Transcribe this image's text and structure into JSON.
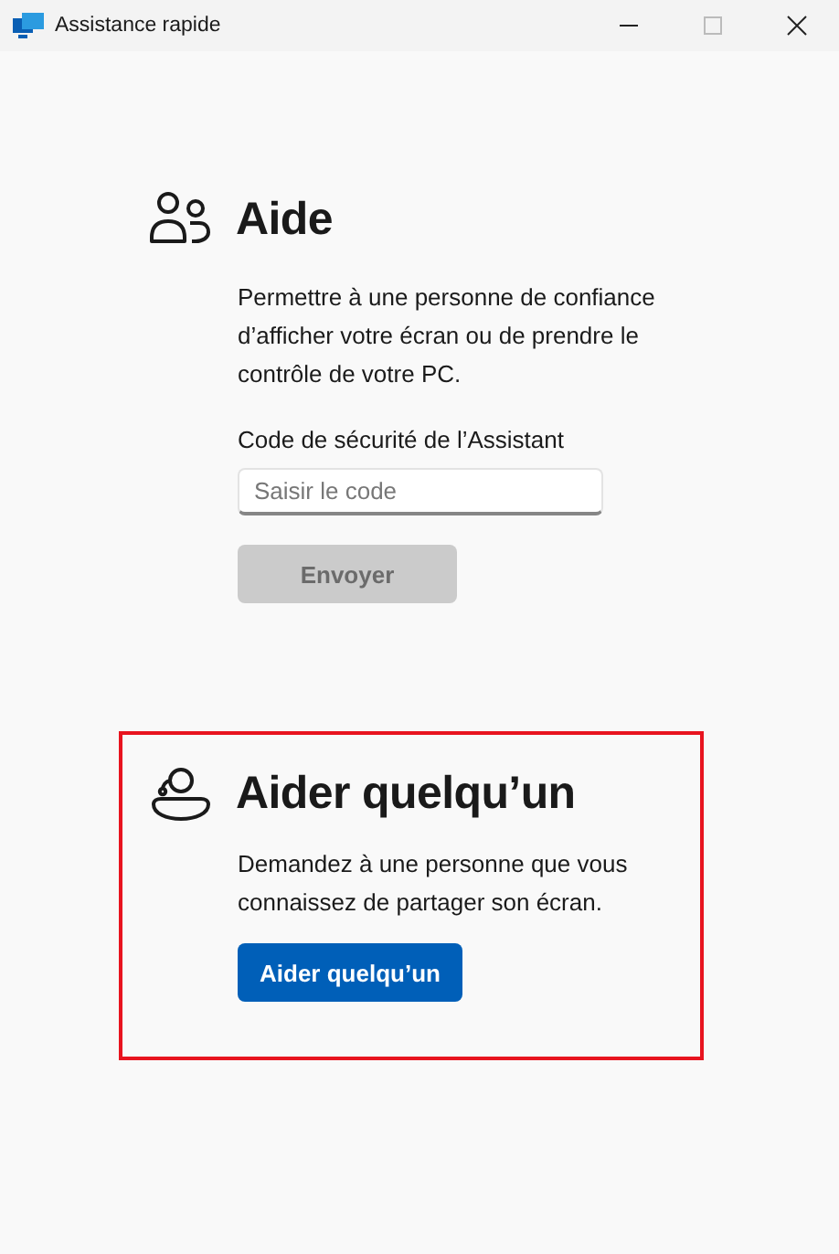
{
  "window": {
    "title": "Assistance rapide"
  },
  "get_help": {
    "heading": "Aide",
    "description": "Permettre à une personne de confiance d’afficher votre écran ou de prendre le contrôle de votre PC.",
    "code_label": "Code de sécurité de l’Assistant",
    "code_field": {
      "placeholder": "Saisir le code"
    },
    "submit_button": {
      "label": "Envoyer",
      "disabled": true
    }
  },
  "help_someone": {
    "heading": "Aider quelqu’un",
    "description": "Demandez à une personne que vous connaissez de partager son écran.",
    "button": {
      "label": "Aider quelqu’un"
    },
    "highlighted": true
  }
}
